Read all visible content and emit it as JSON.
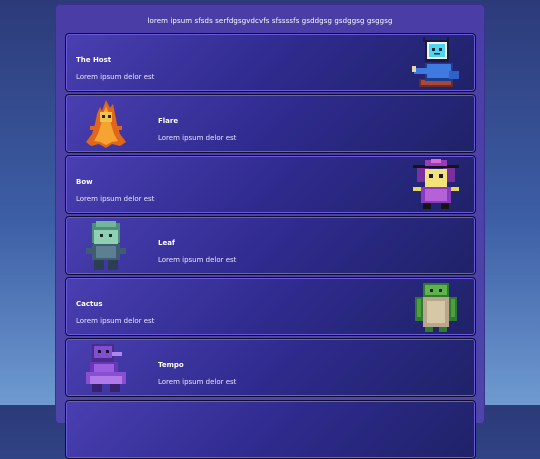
{
  "header": {
    "text": "lorem ipsum sfsds serfdgsgvdcvfs sfssssfs gsddgsg gsdggsg gsggsg"
  },
  "cards": [
    {
      "name": "The Host",
      "description": "Lorem ipsum delor est",
      "sprite_icon": "tv-head-character-icon"
    },
    {
      "name": "Flare",
      "description": "Lorem ipsum delor est",
      "sprite_icon": "flame-character-icon"
    },
    {
      "name": "Bow",
      "description": "Lorem ipsum delor est",
      "sprite_icon": "purple-bow-character-icon"
    },
    {
      "name": "Leaf",
      "description": "Lorem ipsum delor est",
      "sprite_icon": "leaf-character-icon"
    },
    {
      "name": "Cactus",
      "description": "Lorem ipsum delor est",
      "sprite_icon": "cactus-character-icon"
    },
    {
      "name": "Tempo",
      "description": "Lorem ipsum delor est",
      "sprite_icon": "tempo-character-icon"
    }
  ]
}
